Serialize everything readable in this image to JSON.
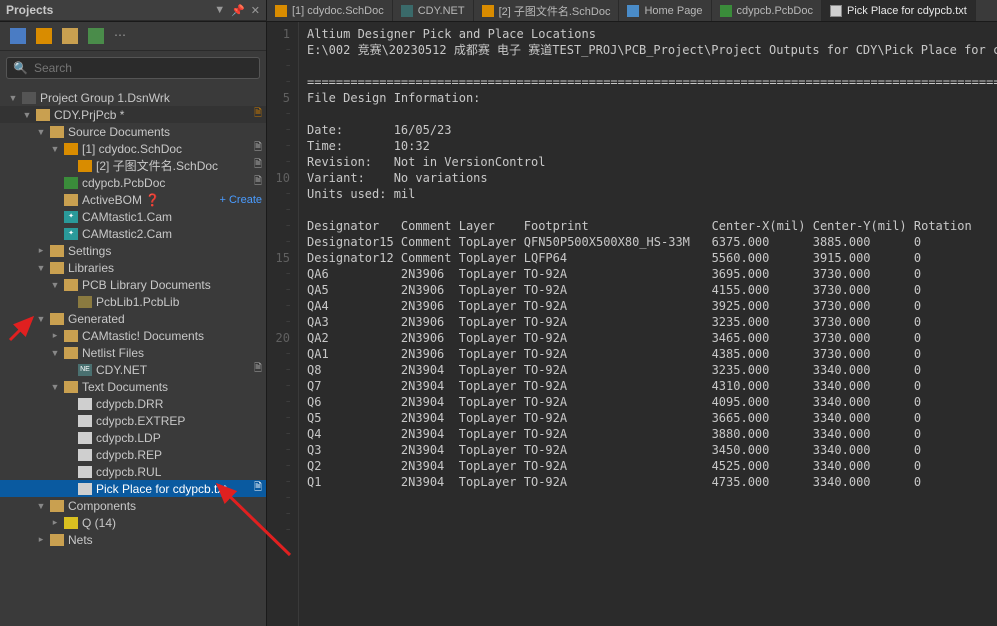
{
  "panel": {
    "title": "Projects",
    "search_placeholder": "Search",
    "group": "Project Group 1.DsnWrk"
  },
  "tabs": [
    {
      "icon": "sch",
      "label": "[1] cdydoc.SchDoc"
    },
    {
      "icon": "net",
      "label": "CDY.NET"
    },
    {
      "icon": "sch",
      "label": "[2] 子图文件名.SchDoc"
    },
    {
      "icon": "home",
      "label": "Home Page"
    },
    {
      "icon": "pcb",
      "label": "cdypcb.PcbDoc"
    },
    {
      "icon": "txt",
      "label": "Pick Place for cdypcb.txt",
      "active": true
    }
  ],
  "tree": [
    {
      "d": 0,
      "chev": "▼",
      "ic": "folder-dk",
      "label": "Project Group 1.DsnWrk"
    },
    {
      "d": 1,
      "chev": "▼",
      "ic": "folder",
      "label": "CDY.PrjPcb *",
      "dark": true,
      "status": "D",
      "scol": "#c97a00"
    },
    {
      "d": 2,
      "chev": "▼",
      "ic": "folder",
      "label": "Source Documents"
    },
    {
      "d": 3,
      "chev": "▼",
      "ic": "doc-sch",
      "label": "[1] cdydoc.SchDoc",
      "status": "D",
      "scol": "#aaa"
    },
    {
      "d": 4,
      "chev": "",
      "ic": "doc-sch",
      "label": "[2] 子图文件名.SchDoc",
      "status": "D",
      "scol": "#aaa"
    },
    {
      "d": 3,
      "chev": "",
      "ic": "doc-pcb",
      "label": "cdypcb.PcbDoc",
      "status": "D",
      "scol": "#aaa"
    },
    {
      "d": 3,
      "chev": "",
      "ic": "folder",
      "label": "ActiveBOM ❓",
      "create": "+ Create"
    },
    {
      "d": 3,
      "chev": "",
      "ic": "doc-cam",
      "label": "CAMtastic1.Cam",
      "sym": "✦"
    },
    {
      "d": 3,
      "chev": "",
      "ic": "doc-cam",
      "label": "CAMtastic2.Cam",
      "sym": "✦"
    },
    {
      "d": 2,
      "chev": "▸",
      "ic": "folder",
      "label": "Settings"
    },
    {
      "d": 2,
      "chev": "▼",
      "ic": "folder",
      "label": "Libraries"
    },
    {
      "d": 3,
      "chev": "▼",
      "ic": "folder",
      "label": "PCB Library Documents"
    },
    {
      "d": 4,
      "chev": "",
      "ic": "doc-lib",
      "label": "PcbLib1.PcbLib"
    },
    {
      "d": 2,
      "chev": "▼",
      "ic": "folder",
      "label": "Generated"
    },
    {
      "d": 3,
      "chev": "▸",
      "ic": "folder",
      "label": "CAMtastic! Documents"
    },
    {
      "d": 3,
      "chev": "▼",
      "ic": "folder",
      "label": "Netlist Files"
    },
    {
      "d": 4,
      "chev": "",
      "ic": "doc-net",
      "label": "CDY.NET",
      "sym": "NE",
      "status": "D",
      "scol": "#aaa"
    },
    {
      "d": 3,
      "chev": "▼",
      "ic": "folder",
      "label": "Text Documents"
    },
    {
      "d": 4,
      "chev": "",
      "ic": "doc-txt",
      "label": "cdypcb.DRR"
    },
    {
      "d": 4,
      "chev": "",
      "ic": "doc-txt",
      "label": "cdypcb.EXTREP"
    },
    {
      "d": 4,
      "chev": "",
      "ic": "doc-txt",
      "label": "cdypcb.LDP"
    },
    {
      "d": 4,
      "chev": "",
      "ic": "doc-txt",
      "label": "cdypcb.REP"
    },
    {
      "d": 4,
      "chev": "",
      "ic": "doc-txt",
      "label": "cdypcb.RUL"
    },
    {
      "d": 4,
      "chev": "",
      "ic": "doc-txt",
      "label": "Pick Place for cdypcb.txt",
      "selected": true,
      "status": "D",
      "scol": "#fff"
    },
    {
      "d": 2,
      "chev": "▼",
      "ic": "folder",
      "label": "Components"
    },
    {
      "d": 3,
      "chev": "▸",
      "ic": "comp-y",
      "label": "Q (14)"
    },
    {
      "d": 2,
      "chev": "▸",
      "ic": "folder",
      "label": "Nets"
    }
  ],
  "gutter": [
    "1",
    "-",
    "-",
    "-",
    "5",
    "-",
    "-",
    "-",
    "-",
    "10",
    "-",
    "-",
    "-",
    "-",
    "15",
    "-",
    "-",
    "-",
    "-",
    "20",
    "-",
    "-",
    "-",
    "-",
    "-",
    "-",
    "-",
    "-",
    "-",
    "-",
    "-",
    "-"
  ],
  "code": "Altium Designer Pick and Place Locations\nE:\\002 竞赛\\20230512 成都赛 电子 赛道TEST_PROJ\\PCB_Project\\Project Outputs for CDY\\Pick Place for cdyp\n\n========================================================================================================================\nFile Design Information:\n\nDate:       16/05/23\nTime:       10:32\nRevision:   Not in VersionControl\nVariant:    No variations\nUnits used: mil\n\nDesignator   Comment Layer    Footprint                 Center-X(mil) Center-Y(mil) Rotation \nDesignator15 Comment TopLayer QFN50P500X500X80_HS-33M   6375.000      3885.000      0        \nDesignator12 Comment TopLayer LQFP64                    5560.000      3915.000      0        \nQA6          2N3906  TopLayer TO-92A                    3695.000      3730.000      0        \nQA5          2N3906  TopLayer TO-92A                    4155.000      3730.000      0        \nQA4          2N3906  TopLayer TO-92A                    3925.000      3730.000      0        \nQA3          2N3906  TopLayer TO-92A                    3235.000      3730.000      0        \nQA2          2N3906  TopLayer TO-92A                    3465.000      3730.000      0        \nQA1          2N3906  TopLayer TO-92A                    4385.000      3730.000      0        \nQ8           2N3904  TopLayer TO-92A                    3235.000      3340.000      0        \nQ7           2N3904  TopLayer TO-92A                    4310.000      3340.000      0        \nQ6           2N3904  TopLayer TO-92A                    4095.000      3340.000      0        \nQ5           2N3904  TopLayer TO-92A                    3665.000      3340.000      0        \nQ4           2N3904  TopLayer TO-92A                    3880.000      3340.000      0        \nQ3           2N3904  TopLayer TO-92A                    3450.000      3340.000      0        \nQ2           2N3904  TopLayer TO-92A                    4525.000      3340.000      0        \nQ1           2N3904  TopLayer TO-92A                    4735.000      3340.000      0        \n"
}
